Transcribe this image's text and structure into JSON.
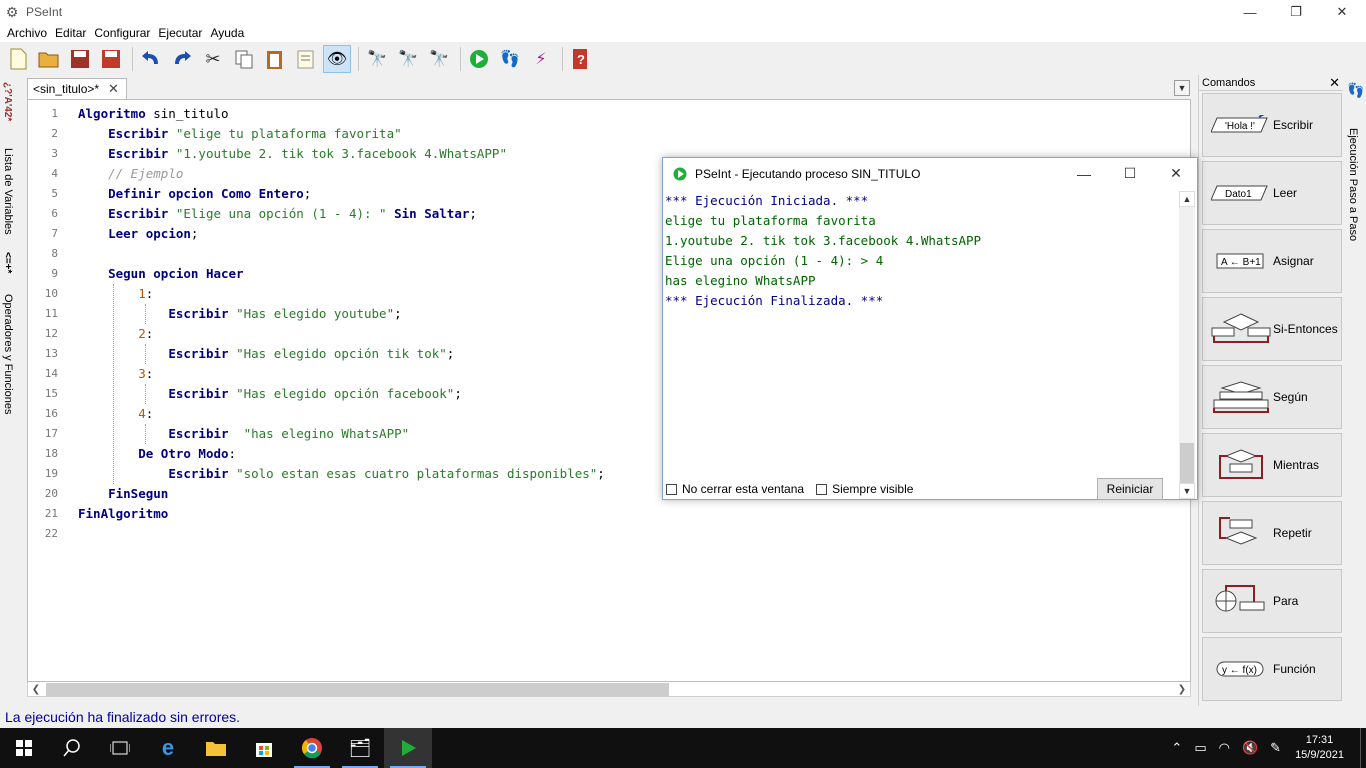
{
  "window": {
    "title": "PSeInt"
  },
  "menu": [
    "Archivo",
    "Editar",
    "Configurar",
    "Ejecutar",
    "Ayuda"
  ],
  "toolbar": {
    "items": [
      "new-file-icon",
      "open-file-icon",
      "save-icon",
      "save-as-icon",
      "undo-icon",
      "redo-icon",
      "cut-icon",
      "copy-icon",
      "paste-icon",
      "edit-icon",
      "indent-icon",
      "find-icon",
      "find-prev-icon",
      "find-next-icon",
      "run-icon",
      "step-icon",
      "debug-icon",
      "help-icon"
    ]
  },
  "left_tabs": {
    "variables": "Lista de Variables",
    "operators": "Operadores y Funciones"
  },
  "editor": {
    "tab_label": "<sin_titulo>*",
    "line_numbers": [
      "1",
      "2",
      "3",
      "4",
      "5",
      "6",
      "7",
      "8",
      "9",
      "10",
      "11",
      "12",
      "13",
      "14",
      "15",
      "16",
      "17",
      "18",
      "19",
      "20",
      "21",
      "22"
    ],
    "lines": [
      [
        {
          "t": "Algoritmo",
          "c": "kw"
        },
        {
          "t": " sin_titulo",
          "c": ""
        }
      ],
      [
        {
          "t": "    ",
          "c": ""
        },
        {
          "t": "Escribir",
          "c": "kw"
        },
        {
          "t": " ",
          "c": ""
        },
        {
          "t": "\"elige tu plataforma favorita\"",
          "c": "str"
        }
      ],
      [
        {
          "t": "    ",
          "c": ""
        },
        {
          "t": "Escribir",
          "c": "kw"
        },
        {
          "t": " ",
          "c": ""
        },
        {
          "t": "\"1.youtube 2. tik tok 3.facebook 4.WhatsAPP\"",
          "c": "str"
        }
      ],
      [
        {
          "t": "    ",
          "c": ""
        },
        {
          "t": "// Ejemplo",
          "c": "cmt"
        }
      ],
      [
        {
          "t": "    ",
          "c": ""
        },
        {
          "t": "Definir opcion Como Entero",
          "c": "kw"
        },
        {
          "t": ";",
          "c": ""
        }
      ],
      [
        {
          "t": "    ",
          "c": ""
        },
        {
          "t": "Escribir",
          "c": "kw"
        },
        {
          "t": " ",
          "c": ""
        },
        {
          "t": "\"Elige una opción (1 - 4): \"",
          "c": "str"
        },
        {
          "t": " ",
          "c": ""
        },
        {
          "t": "Sin Saltar",
          "c": "kw"
        },
        {
          "t": ";",
          "c": ""
        }
      ],
      [
        {
          "t": "    ",
          "c": ""
        },
        {
          "t": "Leer opcion",
          "c": "kw"
        },
        {
          "t": ";",
          "c": ""
        }
      ],
      [
        {
          "t": "",
          "c": ""
        }
      ],
      [
        {
          "t": "    ",
          "c": ""
        },
        {
          "t": "Segun opcion Hacer",
          "c": "kw"
        }
      ],
      [
        {
          "t": "        ",
          "c": ""
        },
        {
          "t": "1",
          "c": "num"
        },
        {
          "t": ":",
          "c": ""
        }
      ],
      [
        {
          "t": "            ",
          "c": ""
        },
        {
          "t": "Escribir",
          "c": "kw"
        },
        {
          "t": " ",
          "c": ""
        },
        {
          "t": "\"Has elegido youtube\"",
          "c": "str"
        },
        {
          "t": ";",
          "c": ""
        }
      ],
      [
        {
          "t": "        ",
          "c": ""
        },
        {
          "t": "2",
          "c": "num"
        },
        {
          "t": ":",
          "c": ""
        }
      ],
      [
        {
          "t": "            ",
          "c": ""
        },
        {
          "t": "Escribir",
          "c": "kw"
        },
        {
          "t": " ",
          "c": ""
        },
        {
          "t": "\"Has elegido opción tik tok\"",
          "c": "str"
        },
        {
          "t": ";",
          "c": ""
        }
      ],
      [
        {
          "t": "        ",
          "c": ""
        },
        {
          "t": "3",
          "c": "num"
        },
        {
          "t": ":",
          "c": ""
        }
      ],
      [
        {
          "t": "            ",
          "c": ""
        },
        {
          "t": "Escribir",
          "c": "kw"
        },
        {
          "t": " ",
          "c": ""
        },
        {
          "t": "\"Has elegido opción facebook\"",
          "c": "str"
        },
        {
          "t": ";",
          "c": ""
        }
      ],
      [
        {
          "t": "        ",
          "c": ""
        },
        {
          "t": "4",
          "c": "num"
        },
        {
          "t": ":",
          "c": ""
        }
      ],
      [
        {
          "t": "            ",
          "c": ""
        },
        {
          "t": "Escribir",
          "c": "kw"
        },
        {
          "t": "  ",
          "c": ""
        },
        {
          "t": "\"has elegino WhatsAPP\"",
          "c": "str"
        }
      ],
      [
        {
          "t": "        ",
          "c": ""
        },
        {
          "t": "De Otro Modo",
          "c": "kw"
        },
        {
          "t": ":",
          "c": ""
        }
      ],
      [
        {
          "t": "            ",
          "c": ""
        },
        {
          "t": "Escribir",
          "c": "kw"
        },
        {
          "t": " ",
          "c": ""
        },
        {
          "t": "\"solo estan esas cuatro plataformas disponibles\"",
          "c": "str"
        },
        {
          "t": ";",
          "c": ""
        }
      ],
      [
        {
          "t": "    ",
          "c": ""
        },
        {
          "t": "FinSegun",
          "c": "kw"
        }
      ],
      [
        {
          "t": "FinAlgoritmo",
          "c": "kw"
        }
      ],
      [
        {
          "t": "",
          "c": ""
        }
      ]
    ]
  },
  "status": "La ejecución ha finalizado sin errores.",
  "commands": {
    "header": "Comandos",
    "items": [
      {
        "label": "Escribir",
        "icon_text": "'Hola !'"
      },
      {
        "label": "Leer",
        "icon_text": "Dato1"
      },
      {
        "label": "Asignar",
        "icon_text": "A ← B+1"
      },
      {
        "label": "Si-Entonces",
        "icon_text": ""
      },
      {
        "label": "Según",
        "icon_text": ""
      },
      {
        "label": "Mientras",
        "icon_text": ""
      },
      {
        "label": "Repetir",
        "icon_text": ""
      },
      {
        "label": "Para",
        "icon_text": ""
      },
      {
        "label": "Función",
        "icon_text": "y ← f(x)"
      }
    ]
  },
  "right_tab": "Ejecución Paso a Paso",
  "popup": {
    "title": "PSeInt - Ejecutando proceso SIN_TITULO",
    "lines": [
      {
        "t": "*** Ejecución Iniciada. ***",
        "sys": true
      },
      {
        "t": "elige tu plataforma favorita",
        "sys": false
      },
      {
        "t": "1.youtube 2. tik tok 3.facebook 4.WhatsAPP",
        "sys": false
      },
      {
        "t": "Elige una opción (1 - 4): > 4",
        "sys": false
      },
      {
        "t": "has elegino WhatsAPP",
        "sys": false
      },
      {
        "t": "*** Ejecución Finalizada. ***",
        "sys": true
      }
    ],
    "no_close_label": "No cerrar esta ventana",
    "always_visible_label": "Siempre visible",
    "restart_label": "Reiniciar"
  },
  "taskbar": {
    "time": "17:31",
    "date": "15/9/2021"
  }
}
